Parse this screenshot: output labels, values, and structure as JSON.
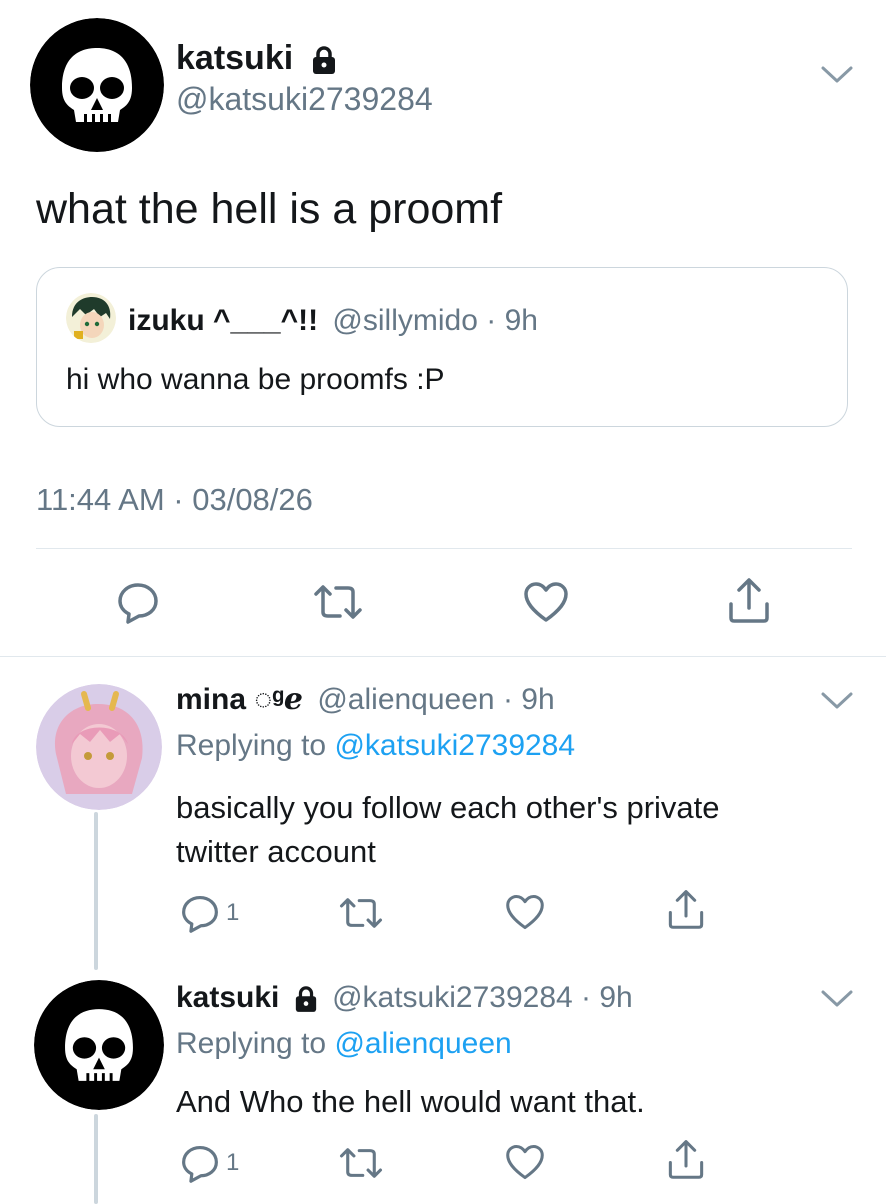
{
  "main_tweet": {
    "display_name": "katsuki",
    "handle": "@katsuki2739284",
    "text": "what the hell is a proomf",
    "timestamp": "11:44 AM · 03/08/26",
    "quote": {
      "display_name": "izuku ^___^!!",
      "handle": "@sillymido",
      "time": "· 9h",
      "text": "hi who wanna be proomfs :P"
    }
  },
  "replies": [
    {
      "display_name": "mina ◌ᵍℯ",
      "handle": "@alienqueen",
      "time": "· 9h",
      "replying_label": "Replying to",
      "replying_to": "@katsuki2739284",
      "text_line1": "basically you follow each other's private",
      "text_line2": "twitter account",
      "reply_count": "1"
    },
    {
      "display_name": "katsuki",
      "handle": "@katsuki2739284",
      "time": "· 9h",
      "replying_label": "Replying to",
      "replying_to": "@alienqueen",
      "text": "And Who the hell would want that.",
      "reply_count": "1"
    }
  ],
  "icons": [
    "skull-avatar",
    "lock-icon",
    "chevron-down-icon",
    "reply-icon",
    "retweet-icon",
    "like-icon",
    "share-icon"
  ],
  "colors": {
    "link": "#1da1f2",
    "muted": "#657786",
    "divider": "#e1e8ed",
    "thread": "#ccd6dd"
  }
}
